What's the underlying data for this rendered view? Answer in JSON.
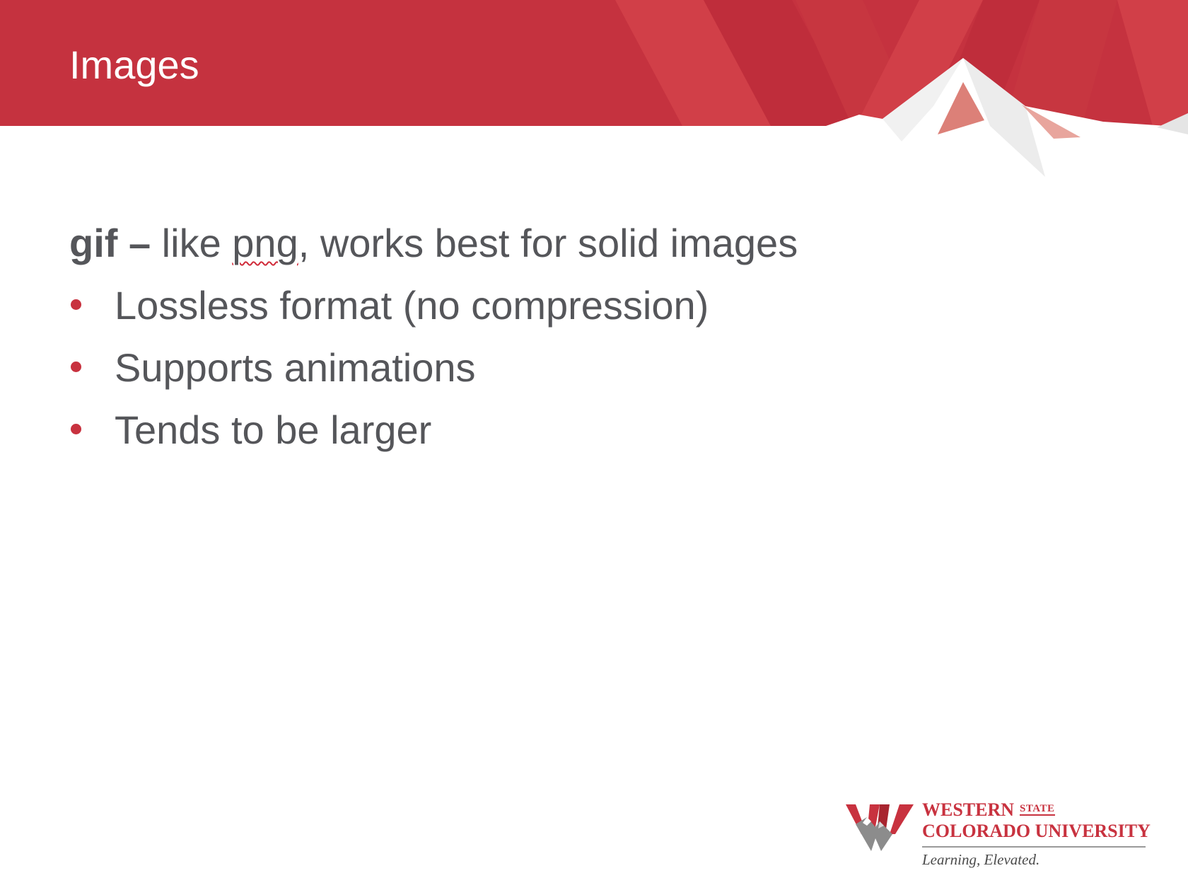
{
  "slide": {
    "title": "Images",
    "intro": {
      "term": "gif –",
      "before_squiggle": " like ",
      "squiggle_word": "png",
      "after_squiggle": ", works best for solid images"
    },
    "bullets": [
      "Lossless format (no compression)",
      "Supports animations",
      "Tends to be larger"
    ]
  },
  "logo": {
    "word1": "WESTERN",
    "state": "STATE",
    "word2": "COLORADO UNIVERSITY",
    "tagline": "Learning, Elevated."
  },
  "colors": {
    "banner_red": "#c8323f",
    "text_gray": "#55565a",
    "bullet_red": "#c8323f"
  }
}
